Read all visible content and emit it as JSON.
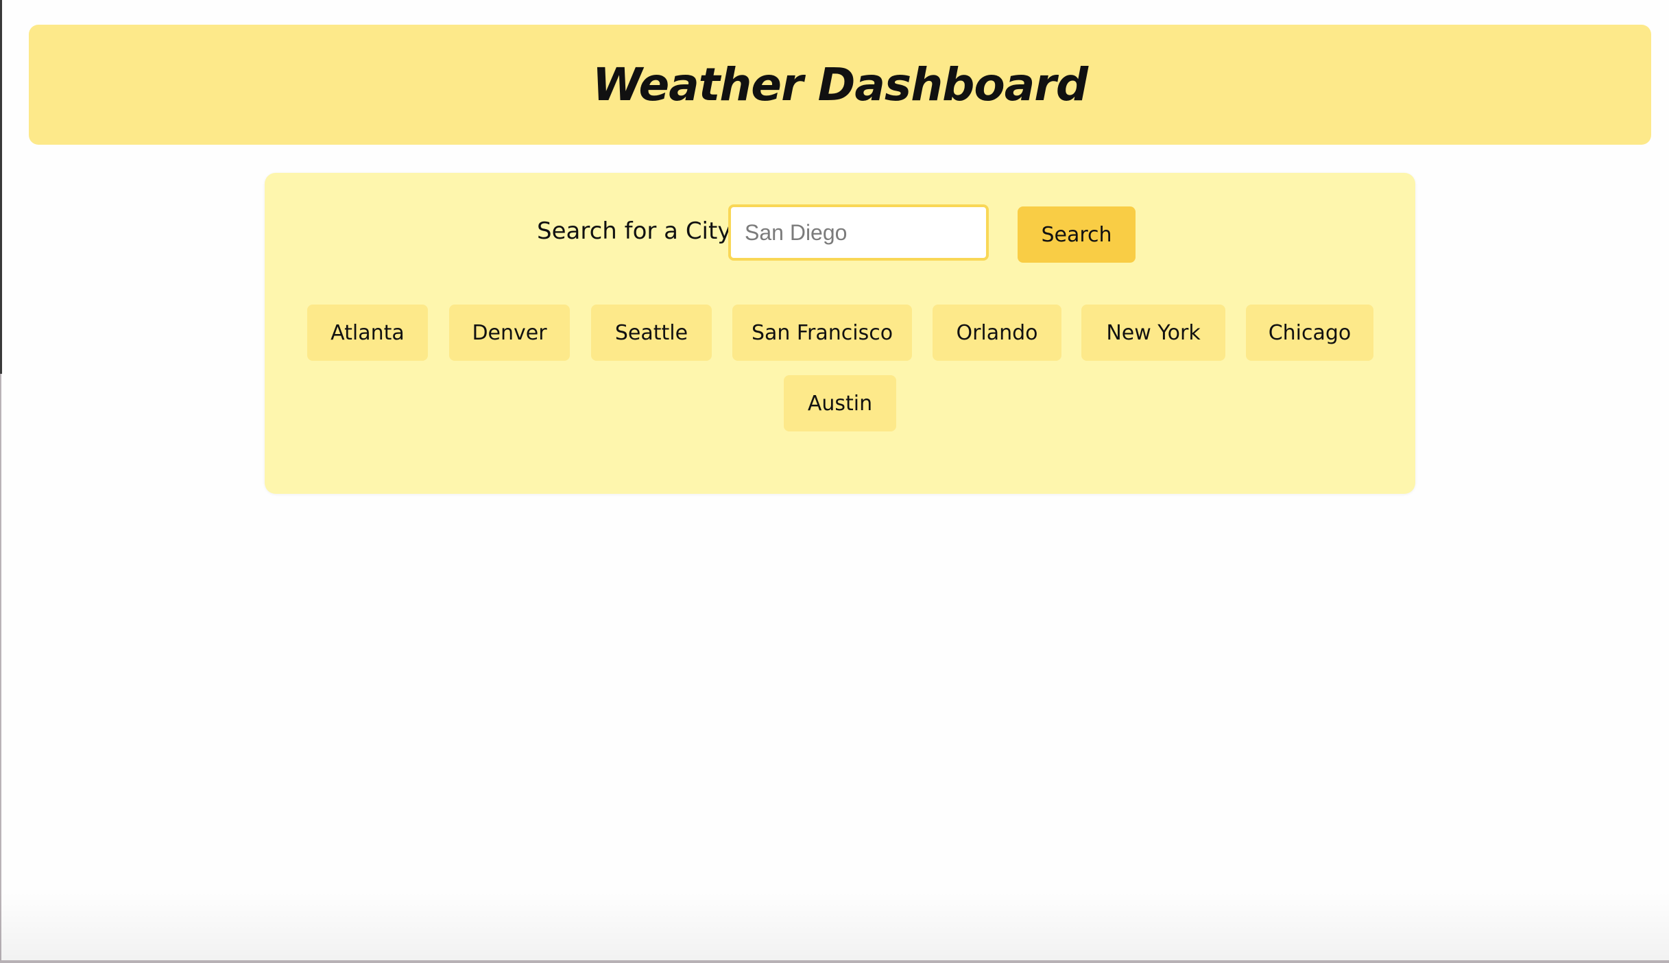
{
  "header": {
    "title": "Weather Dashboard"
  },
  "search": {
    "label": "Search for a City:",
    "placeholder": "San Diego",
    "value": "",
    "button_label": "Search"
  },
  "cities": [
    {
      "label": "Atlanta"
    },
    {
      "label": "Denver"
    },
    {
      "label": "Seattle"
    },
    {
      "label": "San Francisco"
    },
    {
      "label": "Orlando"
    },
    {
      "label": "New York"
    },
    {
      "label": "Chicago"
    },
    {
      "label": "Austin"
    }
  ],
  "colors": {
    "header_bg": "#fde98a",
    "panel_bg": "#fef6ad",
    "search_button_bg": "#f9cd45",
    "city_button_bg": "#fde98a",
    "input_border": "#f9d756"
  }
}
